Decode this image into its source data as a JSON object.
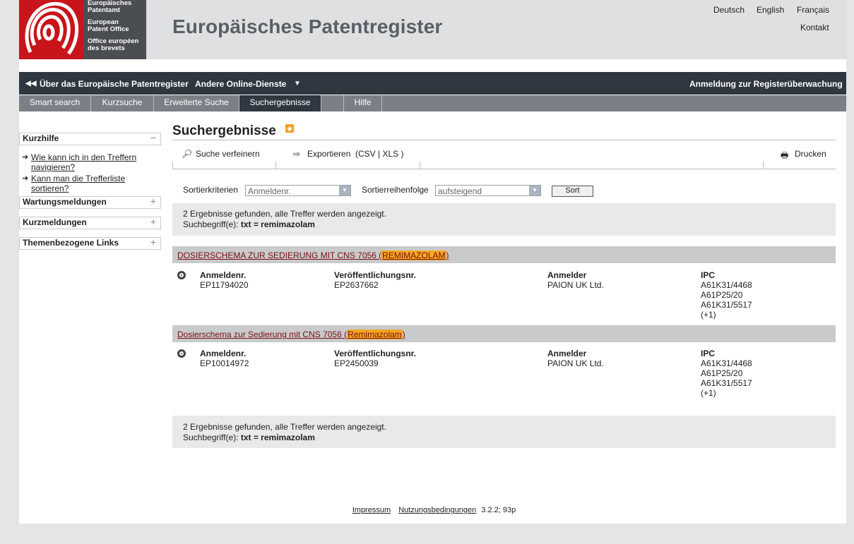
{
  "logo": {
    "lines": [
      "Europäisches",
      "Patentamt",
      "European",
      "Patent Office",
      "Office européen",
      "des brevets"
    ]
  },
  "header": {
    "site_title": "Europäisches Patentregister",
    "lang_de": "Deutsch",
    "lang_en": "English",
    "lang_fr": "Français",
    "contact": "Kontakt"
  },
  "topbar": {
    "about": "Über das Europäische Patentregister",
    "other_services": "Andere Online-Dienste",
    "monitoring": "Anmeldung zur Registerüberwachung"
  },
  "tabs": [
    "Smart search",
    "Kurzsuche",
    "Erweiterte Suche",
    "Suchergebnisse",
    "",
    "Hilfe"
  ],
  "sidebar": {
    "quickhelp": "Kurzhilfe",
    "link1": "Wie kann ich in den Treffern navigieren?",
    "link2": "Kann man die Trefferliste sortieren?",
    "maintenance": "Wartungsmeldungen",
    "news": "Kurzmeldungen",
    "links": "Themenbezogene Links"
  },
  "main": {
    "title": "Suchergebnisse",
    "refine": "Suche verfeinern",
    "export": "Exportieren",
    "export_formats": "(CSV | XLS )",
    "print": "Drucken",
    "sort_label": "Sortierkriterien",
    "sort_value": "Anmeldenr.",
    "order_label": "Sortierreihenfolge",
    "order_value": "aufsteigend",
    "sort_button": "Sort",
    "info_count": "2 Ergebnisse gefunden, alle Treffer werden angezeigt.",
    "info_term_label": "Suchbegriff(e):",
    "info_term": "txt = remimazolam"
  },
  "results": [
    {
      "title_prefix": "DOSIERSCHEMA ZUR SEDIERUNG MIT CNS 7056 (",
      "title_highlight": "REMIMAZOLAM",
      "title_suffix": ")",
      "app_label": "Anmeldenr.",
      "app_no": "EP11794020",
      "pub_label": "Veröffentlichungsnr.",
      "pub_no": "EP2637662",
      "applicant_label": "Anmelder",
      "applicant": "PAION UK Ltd.",
      "ipc_label": "IPC",
      "ipc": [
        "A61K31/4468",
        "A61P25/20",
        "A61K31/5517",
        "(+1)"
      ]
    },
    {
      "title_prefix": "Dosierschema zur Sedierung mit CNS 7056 (",
      "title_highlight": "Remimazolam",
      "title_suffix": ")",
      "app_label": "Anmeldenr.",
      "app_no": "EP10014972",
      "pub_label": "Veröffentlichungsnr.",
      "pub_no": "EP2450039",
      "applicant_label": "Anmelder",
      "applicant": "PAION UK Ltd.",
      "ipc_label": "IPC",
      "ipc": [
        "A61K31/4468",
        "A61P25/20",
        "A61K31/5517",
        "(+1)"
      ]
    }
  ],
  "footer": {
    "imprint": "Impressum",
    "terms": "Nutzungsbedingungen",
    "version": "3.2.2; 93p"
  },
  "colors": {
    "accent_red": "#c8141b",
    "topbar": "#2f3740",
    "highlight": "#f6a623"
  }
}
